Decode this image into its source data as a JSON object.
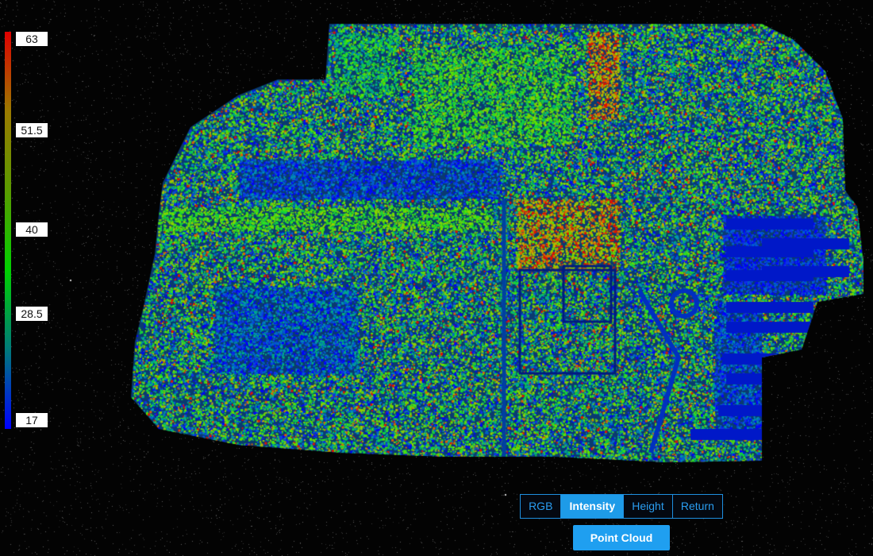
{
  "legend": {
    "title": "",
    "ticks": [
      "63",
      "51.5",
      "40",
      "28.5",
      "17"
    ],
    "gradient_colors": [
      "#e00000",
      "#9a7a00",
      "#5a9a00",
      "#00d000",
      "#007a7a",
      "#0000ff"
    ]
  },
  "modes": {
    "items": [
      "RGB",
      "Intensity",
      "Height",
      "Return"
    ],
    "active": "Intensity"
  },
  "point_cloud_button": {
    "label": "Point Cloud"
  },
  "colors": {
    "background": "#030303",
    "accent": "#1f9ff0"
  },
  "icons": []
}
